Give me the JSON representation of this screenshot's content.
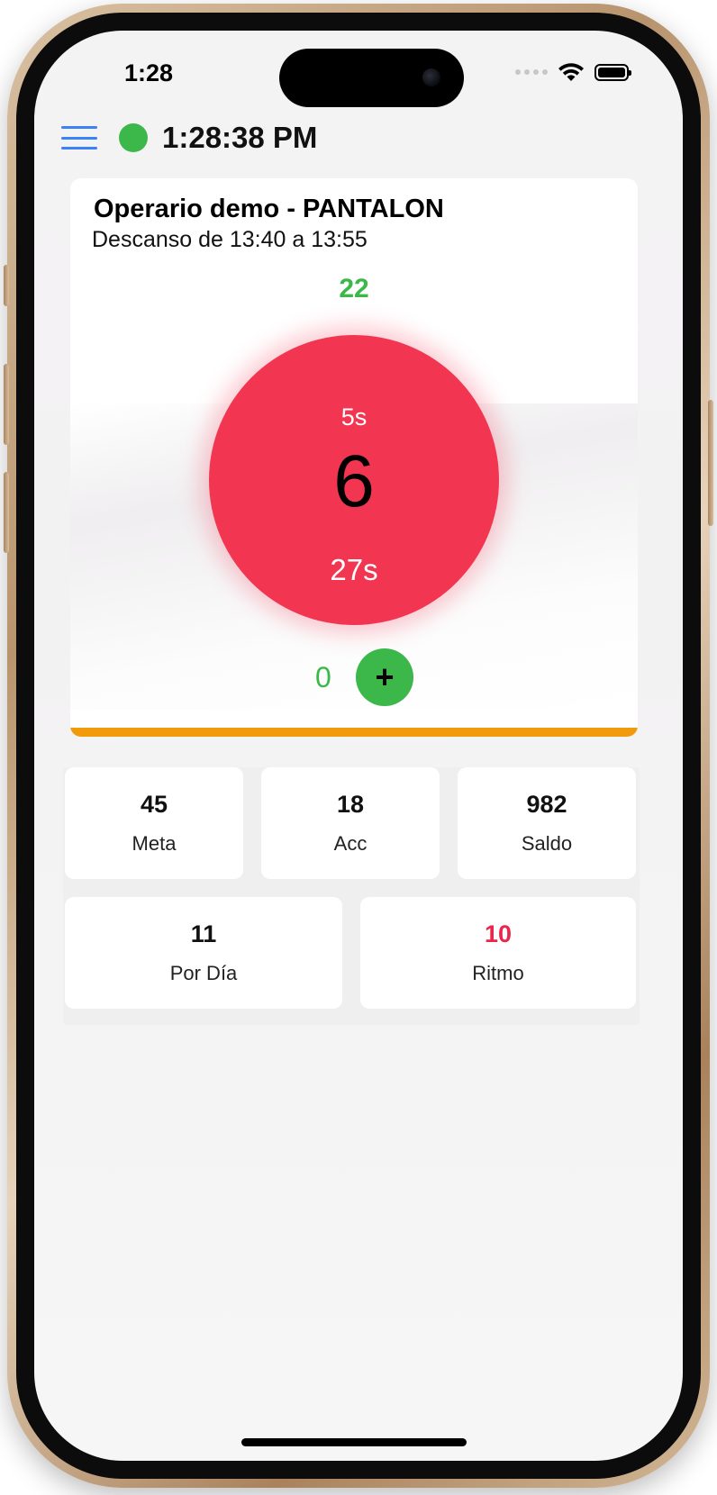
{
  "status_bar": {
    "time": "1:28"
  },
  "header": {
    "clock": "1:28:38 PM"
  },
  "operator_card": {
    "title": "Operario demo - PANTALON",
    "subtitle": "Descanso de 13:40 a 13:55",
    "top_count": "22",
    "timer": {
      "top_label": "5s",
      "main_value": "6",
      "bottom_label": "27s",
      "color": "#f23551"
    },
    "add_count": "0",
    "add_button_label": "+",
    "progress_color": "#f09a0c"
  },
  "stats": [
    {
      "value": "45",
      "label": "Meta"
    },
    {
      "value": "18",
      "label": "Acc"
    },
    {
      "value": "982",
      "label": "Saldo"
    },
    {
      "value": "11",
      "label": "Por Día"
    },
    {
      "value": "10",
      "label": "Ritmo",
      "value_color": "#e8274a"
    }
  ],
  "colors": {
    "accent_green": "#3cb84b",
    "menu_blue": "#3b82f6"
  }
}
